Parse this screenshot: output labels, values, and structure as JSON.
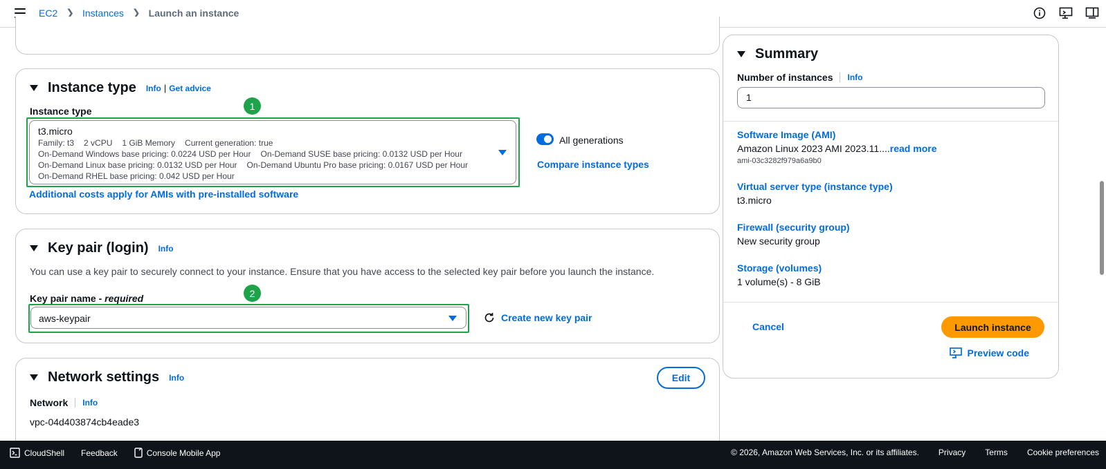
{
  "breadcrumb": {
    "items": [
      {
        "label": "EC2"
      },
      {
        "label": "Instances"
      }
    ],
    "current": "Launch an instance"
  },
  "instance_type": {
    "title": "Instance type",
    "info": "Info",
    "get_advice": "Get advice",
    "field_label": "Instance type",
    "selected": {
      "name": "t3.micro",
      "family": "Family: t3",
      "vcpu": "2 vCPU",
      "memory": "1 GiB Memory",
      "generation": "Current generation: true",
      "windows": "On-Demand Windows base pricing: 0.0224 USD per Hour",
      "suse": "On-Demand SUSE base pricing: 0.0132 USD per Hour",
      "linux": "On-Demand Linux base pricing: 0.0132 USD per Hour",
      "ubuntu": "On-Demand Ubuntu Pro base pricing: 0.0167 USD per Hour",
      "rhel": "On-Demand RHEL base pricing: 0.042 USD per Hour"
    },
    "all_generations": "All generations",
    "compare": "Compare instance types",
    "additional_costs": "Additional costs apply for AMIs with pre-installed software",
    "badge": "1"
  },
  "key_pair": {
    "title": "Key pair (login)",
    "info": "Info",
    "description": "You can use a key pair to securely connect to your instance. Ensure that you have access to the selected key pair before you launch the instance.",
    "field_label": "Key pair name - ",
    "required": "required",
    "selected": "aws-keypair",
    "create_new": "Create new key pair",
    "badge": "2"
  },
  "network": {
    "title": "Network settings",
    "info": "Info",
    "edit": "Edit",
    "network_label": "Network",
    "network_info": "Info",
    "network_value": "vpc-04d403874cb4eade3"
  },
  "summary": {
    "title": "Summary",
    "num_instances_label": "Number of instances",
    "num_instances_info": "Info",
    "num_instances_value": "1",
    "ami_title": "Software Image (AMI)",
    "ami_value": "Amazon Linux 2023 AMI 2023.11....",
    "ami_read_more": "read more",
    "ami_id": "ami-03c3282f979a6a9b0",
    "server_type_title": "Virtual server type (instance type)",
    "server_type_value": "t3.micro",
    "firewall_title": "Firewall (security group)",
    "firewall_value": "New security group",
    "storage_title": "Storage (volumes)",
    "storage_value": "1 volume(s) - 8 GiB",
    "cancel": "Cancel",
    "launch": "Launch instance",
    "preview": "Preview code"
  },
  "footer": {
    "cloudshell": "CloudShell",
    "feedback": "Feedback",
    "mobile_app": "Console Mobile App",
    "copyright": "© 2026, Amazon Web Services, Inc. or its affiliates.",
    "privacy": "Privacy",
    "terms": "Terms",
    "cookies": "Cookie preferences"
  },
  "colors": {
    "link": "#006ce0",
    "annotation_green": "#1fa34a",
    "launch_orange": "#ff9900",
    "footer_bg": "#0f141a"
  }
}
